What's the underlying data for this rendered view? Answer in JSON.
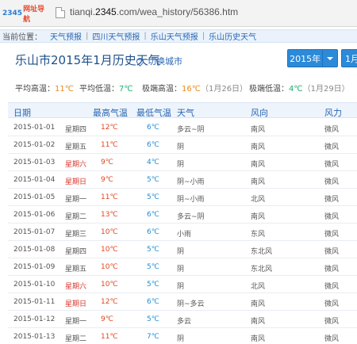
{
  "browser": {
    "bookmark_num": "2345",
    "bookmark_text": "网址导航",
    "url_prefix": "tianqi.",
    "url_domain": "2345",
    "url_rest": ".com/wea_history/56386.htm"
  },
  "breadcrumb": {
    "label": "当前位置：",
    "items": [
      "天气预报",
      "四川天气预报",
      "乐山天气预报",
      "乐山历史天气"
    ]
  },
  "heading": {
    "title": "乐山市2015年1月历史天气",
    "switch_city": "切换城市",
    "year": "2015年",
    "month": "1月"
  },
  "summary": {
    "avg_high_label": "平均高温：",
    "avg_high": "11℃",
    "avg_low_label": "平均低温：",
    "avg_low": "7℃",
    "max_label": "极端高温：",
    "max_val": "16℃",
    "max_date": "（1月26日）",
    "min_label": "极端低温：",
    "min_val": "4℃",
    "min_date": "（1月29日）"
  },
  "table": {
    "headers": [
      "日期",
      "最高气温",
      "最低气温",
      "天气",
      "风向",
      "风力"
    ],
    "rows": [
      {
        "date": "2015-01-01",
        "week": "星期四",
        "hi": "12℃",
        "lo": "6℃",
        "wx": "多云~阴",
        "wd": "南风",
        "wp": "微风",
        "weekend": false
      },
      {
        "date": "2015-01-02",
        "week": "星期五",
        "hi": "11℃",
        "lo": "6℃",
        "wx": "阴",
        "wd": "南风",
        "wp": "微风",
        "weekend": false
      },
      {
        "date": "2015-01-03",
        "week": "星期六",
        "hi": "9℃",
        "lo": "4℃",
        "wx": "阴",
        "wd": "南风",
        "wp": "微风",
        "weekend": true
      },
      {
        "date": "2015-01-04",
        "week": "星期日",
        "hi": "9℃",
        "lo": "5℃",
        "wx": "阴~小雨",
        "wd": "南风",
        "wp": "微风",
        "weekend": true
      },
      {
        "date": "2015-01-05",
        "week": "星期一",
        "hi": "11℃",
        "lo": "5℃",
        "wx": "阴~小雨",
        "wd": "北风",
        "wp": "微风",
        "weekend": false
      },
      {
        "date": "2015-01-06",
        "week": "星期二",
        "hi": "13℃",
        "lo": "6℃",
        "wx": "多云~阴",
        "wd": "南风",
        "wp": "微风",
        "weekend": false
      },
      {
        "date": "2015-01-07",
        "week": "星期三",
        "hi": "10℃",
        "lo": "6℃",
        "wx": "小雨",
        "wd": "东风",
        "wp": "微风",
        "weekend": false
      },
      {
        "date": "2015-01-08",
        "week": "星期四",
        "hi": "10℃",
        "lo": "5℃",
        "wx": "阴",
        "wd": "东北风",
        "wp": "微风",
        "weekend": false
      },
      {
        "date": "2015-01-09",
        "week": "星期五",
        "hi": "10℃",
        "lo": "5℃",
        "wx": "阴",
        "wd": "东北风",
        "wp": "微风",
        "weekend": false
      },
      {
        "date": "2015-01-10",
        "week": "星期六",
        "hi": "10℃",
        "lo": "5℃",
        "wx": "阴",
        "wd": "北风",
        "wp": "微风",
        "weekend": true
      },
      {
        "date": "2015-01-11",
        "week": "星期日",
        "hi": "12℃",
        "lo": "6℃",
        "wx": "阴~多云",
        "wd": "南风",
        "wp": "微风",
        "weekend": true
      },
      {
        "date": "2015-01-12",
        "week": "星期一",
        "hi": "9℃",
        "lo": "5℃",
        "wx": "多云",
        "wd": "南风",
        "wp": "微风",
        "weekend": false
      },
      {
        "date": "2015-01-13",
        "week": "星期二",
        "hi": "11℃",
        "lo": "7℃",
        "wx": "阴",
        "wd": "南风",
        "wp": "微风",
        "weekend": false
      }
    ]
  },
  "colors": {
    "accent": "#2c8ad8",
    "high_temp": "#e0451f",
    "low_temp": "#1f8ed8",
    "weekend": "#d9342b"
  }
}
